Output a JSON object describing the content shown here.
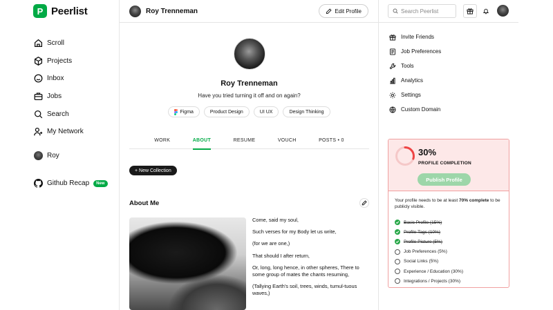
{
  "brand": {
    "name": "Peerlist",
    "logo_letter": "P",
    "accent": "#00aa45"
  },
  "sidebar": {
    "items": [
      {
        "label": "Scroll",
        "icon": "home-icon"
      },
      {
        "label": "Projects",
        "icon": "cube-icon"
      },
      {
        "label": "Inbox",
        "icon": "inbox-icon"
      },
      {
        "label": "Jobs",
        "icon": "briefcase-icon"
      },
      {
        "label": "Search",
        "icon": "search-icon"
      },
      {
        "label": "My Network",
        "icon": "network-icon"
      }
    ],
    "user": {
      "label": "Roy"
    },
    "github": {
      "label": "Github Recap",
      "badge": "New"
    }
  },
  "header": {
    "name": "Roy Trenneman",
    "edit_label": "Edit Profile"
  },
  "profile": {
    "name": "Roy Trenneman",
    "bio": "Have you tried turning it off and on again?",
    "skills": [
      "Figma",
      "Product Design",
      "UI UX",
      "Design Thinking"
    ]
  },
  "tabs": [
    {
      "label": "WORK"
    },
    {
      "label": "ABOUT",
      "active": true
    },
    {
      "label": "RESUME"
    },
    {
      "label": "VOUCH"
    },
    {
      "label": "POSTS • 0"
    }
  ],
  "new_collection_label": "+ New Collection",
  "about": {
    "title": "About Me",
    "lines": [
      "Come, said my soul,",
      "Such verses for my Body let us write,",
      "(for we are one,)",
      "That should I after return,",
      "Or, long, long hence, in other spheres, There to some group of mates the chants resuming,",
      "(Tallying Earth's soil, trees, winds, tumul-tuous waves,)"
    ]
  },
  "topright": {
    "search_placeholder": "Search Peerlist"
  },
  "menu": [
    {
      "label": "Invite Friends",
      "icon": "gift-icon"
    },
    {
      "label": "Job Preferences",
      "icon": "document-icon"
    },
    {
      "label": "Tools",
      "icon": "wrench-icon"
    },
    {
      "label": "Analytics",
      "icon": "bar-chart-icon"
    },
    {
      "label": "Settings",
      "icon": "gear-icon"
    },
    {
      "label": "Custom Domain",
      "icon": "globe-icon"
    }
  ],
  "completion": {
    "percent": "30%",
    "percent_value": 0.3,
    "label": "PROFILE COMPLETION",
    "publish_label": "Publish Profile",
    "message_pre": "Your profile needs to be at least ",
    "message_bold": "70% complete",
    "message_post": " to be publicly visible.",
    "items": [
      {
        "label": "Basic Profile (15%)",
        "done": true
      },
      {
        "label": "Profile Tags (10%)",
        "done": true
      },
      {
        "label": "Profile Picture (5%)",
        "done": true
      },
      {
        "label": "Job Preferences (5%)",
        "done": false
      },
      {
        "label": "Social Links (5%)",
        "done": false
      },
      {
        "label": "Experience / Education (30%)",
        "done": false
      },
      {
        "label": "Integrations / Projects (30%)",
        "done": false
      }
    ]
  }
}
